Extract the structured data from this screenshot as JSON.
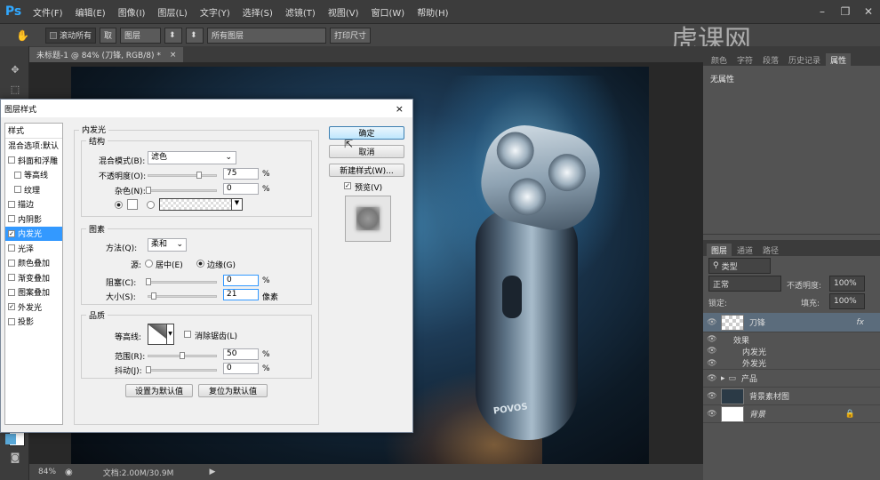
{
  "app": {
    "logo": "Ps"
  },
  "menu": [
    "文件(F)",
    "编辑(E)",
    "图像(I)",
    "图层(L)",
    "文字(Y)",
    "选择(S)",
    "滤镜(T)",
    "视图(V)",
    "窗口(W)",
    "帮助(H)"
  ],
  "options": {
    "scroll_all": "滚动所有",
    "layer_select": "取",
    "layer_dropdown": "图层",
    "all_layers": "所有图层",
    "print_size": "打印尺寸"
  },
  "document": {
    "tab": "未标题-1 @ 84% (刀锋, RGB/8) *",
    "close": "×",
    "zoom": "84%",
    "doc_info": "文档:2.00M/30.9M",
    "brand_text": "POVOS"
  },
  "watermark": "虎课网",
  "panels": {
    "tabs": [
      "颜色",
      "字符",
      "段落",
      "历史记录",
      "属性"
    ],
    "active_tab": "属性",
    "props_text": "无属性"
  },
  "layers_panel": {
    "tabs": [
      "图层",
      "通道",
      "路径"
    ],
    "filter": "类型",
    "blend": "正常",
    "opacity_label": "不透明度:",
    "opacity": "100%",
    "lock_label": "锁定:",
    "fill_label": "填充:",
    "fill": "100%",
    "layers": [
      {
        "name": "刀锋",
        "fx": "fx"
      },
      {
        "name": "效果"
      },
      {
        "name": "内发光"
      },
      {
        "name": "外发光"
      },
      {
        "name": "产品"
      },
      {
        "name": "背景素材图"
      },
      {
        "name": "背景"
      }
    ]
  },
  "dialog": {
    "title": "图层样式",
    "close": "×",
    "styles_header": "样式",
    "blend_options": "混合选项:默认",
    "style_items": [
      {
        "label": "斜面和浮雕",
        "checked": false
      },
      {
        "label": "等高线",
        "checked": false
      },
      {
        "label": "纹理",
        "checked": false
      },
      {
        "label": "描边",
        "checked": false
      },
      {
        "label": "内阴影",
        "checked": false
      },
      {
        "label": "内发光",
        "checked": true
      },
      {
        "label": "光泽",
        "checked": false
      },
      {
        "label": "颜色叠加",
        "checked": false
      },
      {
        "label": "渐变叠加",
        "checked": false
      },
      {
        "label": "图案叠加",
        "checked": false
      },
      {
        "label": "外发光",
        "checked": true
      },
      {
        "label": "投影",
        "checked": false
      }
    ],
    "section_title": "内发光",
    "structure": {
      "title": "结构",
      "blend_label": "混合模式(B):",
      "blend_value": "滤色",
      "opacity_label": "不透明度(O):",
      "opacity_value": "75",
      "opacity_pct": 75,
      "noise_label": "杂色(N):",
      "noise_value": "0",
      "noise_pct": 0,
      "unit": "%"
    },
    "elements": {
      "title": "图素",
      "method_label": "方法(Q):",
      "method_value": "柔和",
      "source_label": "源:",
      "center_label": "居中(E)",
      "edge_label": "边缘(G)",
      "choke_label": "阻塞(C):",
      "choke_value": "0",
      "choke_pct": 0,
      "size_label": "大小(S):",
      "size_value": "21",
      "size_pct": 8,
      "size_unit": "像素",
      "pct": "%"
    },
    "quality": {
      "title": "品质",
      "contour_label": "等高线:",
      "antialias_label": "消除锯齿(L)",
      "range_label": "范围(R):",
      "range_value": "50",
      "range_pct": 50,
      "jitter_label": "抖动(J):",
      "jitter_value": "0",
      "jitter_pct": 0,
      "pct": "%"
    },
    "buttons": {
      "set_default": "设置为默认值",
      "reset_default": "复位为默认值",
      "ok": "确定",
      "cancel": "取消",
      "new_style": "新建样式(W)...",
      "preview": "预览(V)"
    }
  }
}
